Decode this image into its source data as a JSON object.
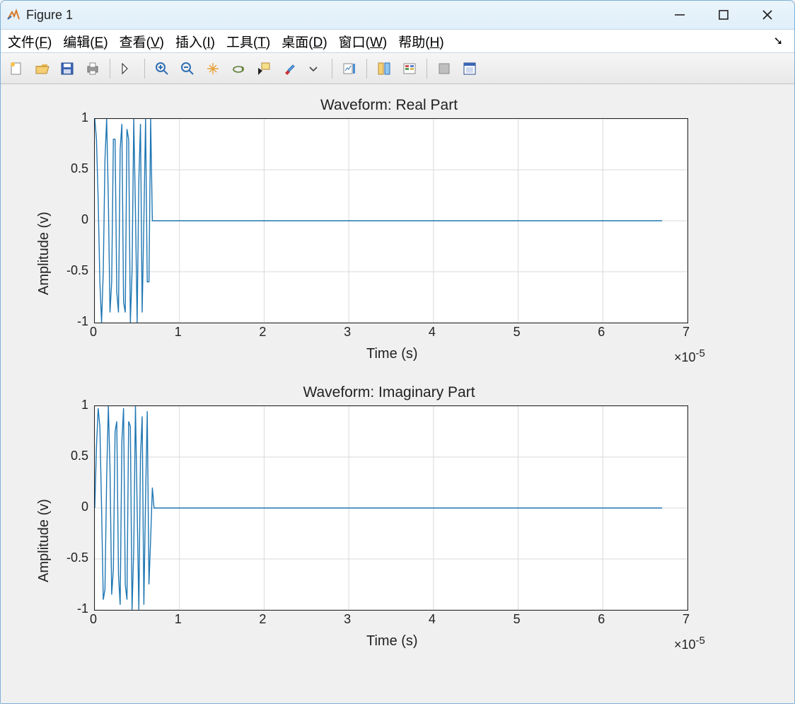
{
  "window": {
    "title": "Figure 1"
  },
  "menu": {
    "file": {
      "label": "文件",
      "mn": "F"
    },
    "edit": {
      "label": "编辑",
      "mn": "E"
    },
    "view": {
      "label": "查看",
      "mn": "V"
    },
    "insert": {
      "label": "插入",
      "mn": "I"
    },
    "tools": {
      "label": "工具",
      "mn": "T"
    },
    "desktop": {
      "label": "桌面",
      "mn": "D"
    },
    "window": {
      "label": "窗口",
      "mn": "W"
    },
    "help": {
      "label": "帮助",
      "mn": "H"
    }
  },
  "toolbar_icons": [
    "new",
    "open",
    "save",
    "print",
    "arrow",
    "zoom-in",
    "zoom-out",
    "pan",
    "rotate",
    "data-cursor",
    "brush",
    "link",
    "colorbar",
    "legend",
    "hide",
    "show"
  ],
  "chart_data": [
    {
      "type": "line",
      "title": "Waveform: Real Part",
      "xlabel": "Time (s)",
      "ylabel": "Amplitude (v)",
      "xlim": [
        0,
        7e-05
      ],
      "ylim": [
        -1,
        1
      ],
      "x_exponent": "×10^{-5}",
      "xticks_display": [
        "0",
        "1",
        "2",
        "3",
        "4",
        "5",
        "6",
        "7"
      ],
      "yticks_display": [
        "-1",
        "-0.5",
        "0",
        "0.5",
        "1"
      ],
      "series": [
        {
          "name": "real",
          "x": [
            0.0,
            0.02,
            0.04,
            0.06,
            0.08,
            0.1,
            0.12,
            0.14,
            0.16,
            0.18,
            0.2,
            0.22,
            0.24,
            0.26,
            0.28,
            0.3,
            0.32,
            0.34,
            0.36,
            0.38,
            0.4,
            0.42,
            0.44,
            0.46,
            0.48,
            0.5,
            0.52,
            0.54,
            0.56,
            0.58,
            0.6,
            0.62,
            0.64,
            0.66,
            0.68,
            0.7,
            6.7
          ],
          "y": [
            1.0,
            0.8,
            0.2,
            -0.6,
            -1.0,
            -0.5,
            0.6,
            1.0,
            0.2,
            -0.9,
            -0.6,
            0.8,
            0.8,
            -0.7,
            -0.9,
            0.7,
            0.95,
            -0.8,
            -0.9,
            0.9,
            0.8,
            -1.0,
            -0.5,
            1.0,
            0.1,
            -1.0,
            0.4,
            0.95,
            -0.9,
            0.0,
            1.0,
            -0.6,
            -0.6,
            1.0,
            0.0,
            0.0,
            0.0
          ],
          "x_scale_note": "x values are in units of 1e-5 s (i.e. match xticks_display); chirp occupies ~0..0.70, then y=0 to end"
        }
      ]
    },
    {
      "type": "line",
      "title": "Waveform: Imaginary Part",
      "xlabel": "Time (s)",
      "ylabel": "Amplitude (v)",
      "xlim": [
        0,
        7e-05
      ],
      "ylim": [
        -1,
        1
      ],
      "x_exponent": "×10^{-5}",
      "xticks_display": [
        "0",
        "1",
        "2",
        "3",
        "4",
        "5",
        "6",
        "7"
      ],
      "yticks_display": [
        "-1",
        "-0.5",
        "0",
        "0.5",
        "1"
      ],
      "series": [
        {
          "name": "imag",
          "x": [
            0.0,
            0.02,
            0.04,
            0.06,
            0.08,
            0.1,
            0.12,
            0.14,
            0.16,
            0.18,
            0.2,
            0.22,
            0.24,
            0.26,
            0.28,
            0.3,
            0.32,
            0.34,
            0.36,
            0.38,
            0.4,
            0.42,
            0.44,
            0.46,
            0.48,
            0.5,
            0.52,
            0.54,
            0.56,
            0.58,
            0.6,
            0.62,
            0.64,
            0.66,
            0.68,
            0.7,
            6.7
          ],
          "y": [
            0.0,
            0.6,
            0.98,
            0.8,
            0.0,
            -0.9,
            -0.8,
            0.3,
            1.0,
            0.4,
            -0.85,
            -0.6,
            0.75,
            0.85,
            -0.65,
            -0.95,
            0.65,
            0.98,
            -0.75,
            -0.9,
            0.85,
            0.8,
            -1.0,
            -0.4,
            1.0,
            0.0,
            -1.0,
            0.5,
            0.9,
            -0.95,
            0.1,
            0.95,
            -0.75,
            -0.3,
            0.2,
            0.0,
            0.0
          ],
          "x_scale_note": "x values are in units of 1e-5 s; chirp occupies ~0..0.70 with small ringdown, then y=0 to end"
        }
      ]
    }
  ]
}
